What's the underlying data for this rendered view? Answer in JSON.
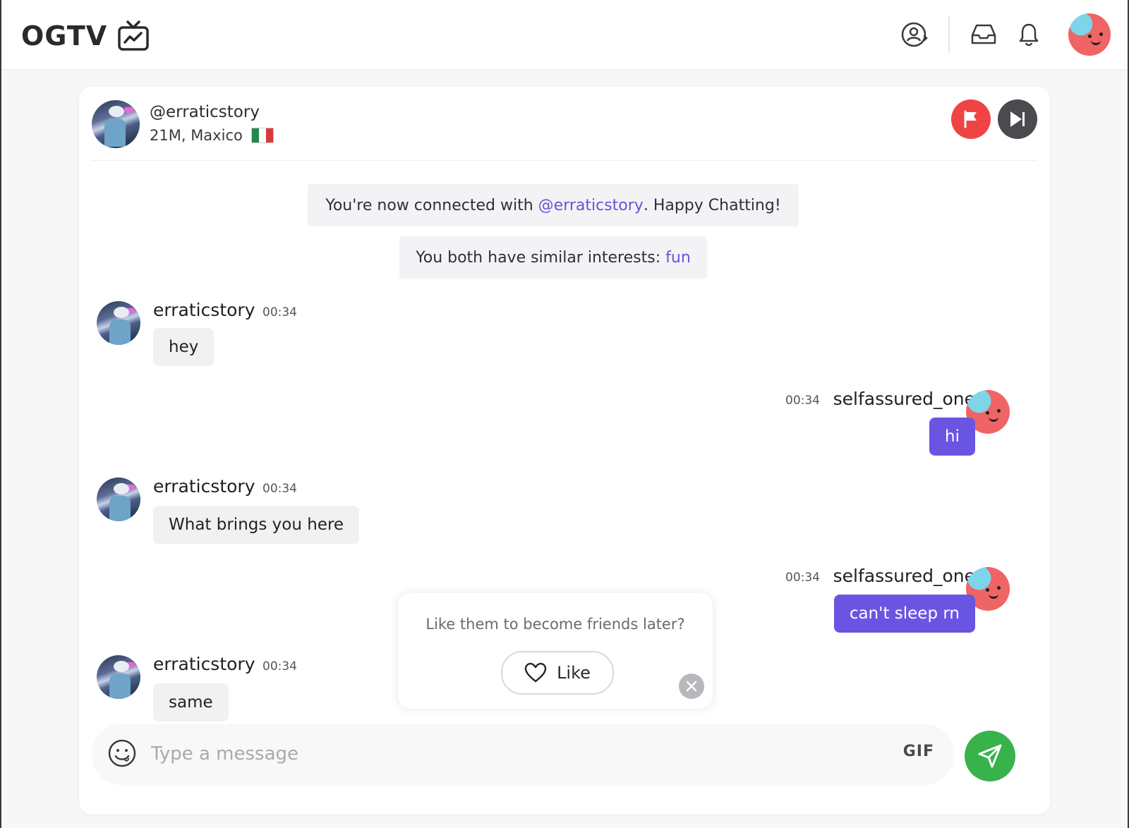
{
  "header": {
    "logo_text": "OGTV",
    "icons": [
      "account-switch-icon",
      "inbox-icon",
      "bell-icon"
    ]
  },
  "partner": {
    "handle": "@erraticstory",
    "meta": "21M, Maxico",
    "country_flag": "mexico-flag-icon"
  },
  "system": {
    "connected_prefix": "You're now connected with ",
    "connected_handle": "@erraticstory",
    "connected_suffix": ". Happy Chatting!",
    "interests_prefix": "You both have similar interests: ",
    "interests_value": "fun"
  },
  "messages": [
    {
      "sender": "erraticstory",
      "time": "00:34",
      "text": "hey",
      "side": "left"
    },
    {
      "sender": "selfassured_one",
      "time": "00:34",
      "text": "hi",
      "side": "right"
    },
    {
      "sender": "erraticstory",
      "time": "00:34",
      "text": "What brings you here",
      "side": "left"
    },
    {
      "sender": "selfassured_one",
      "time": "00:34",
      "text": "can't sleep rn",
      "side": "right"
    },
    {
      "sender": "erraticstory",
      "time": "00:34",
      "text": "same",
      "side": "left"
    }
  ],
  "popup": {
    "question": "Like them to become friends later?",
    "like_label": "Like"
  },
  "composer": {
    "placeholder": "Type a message",
    "gif_label": "GIF"
  },
  "colors": {
    "accent": "#6654d9",
    "outgoing_bubble": "#6a55e3",
    "report": "#ef4444",
    "send": "#38b24a"
  }
}
